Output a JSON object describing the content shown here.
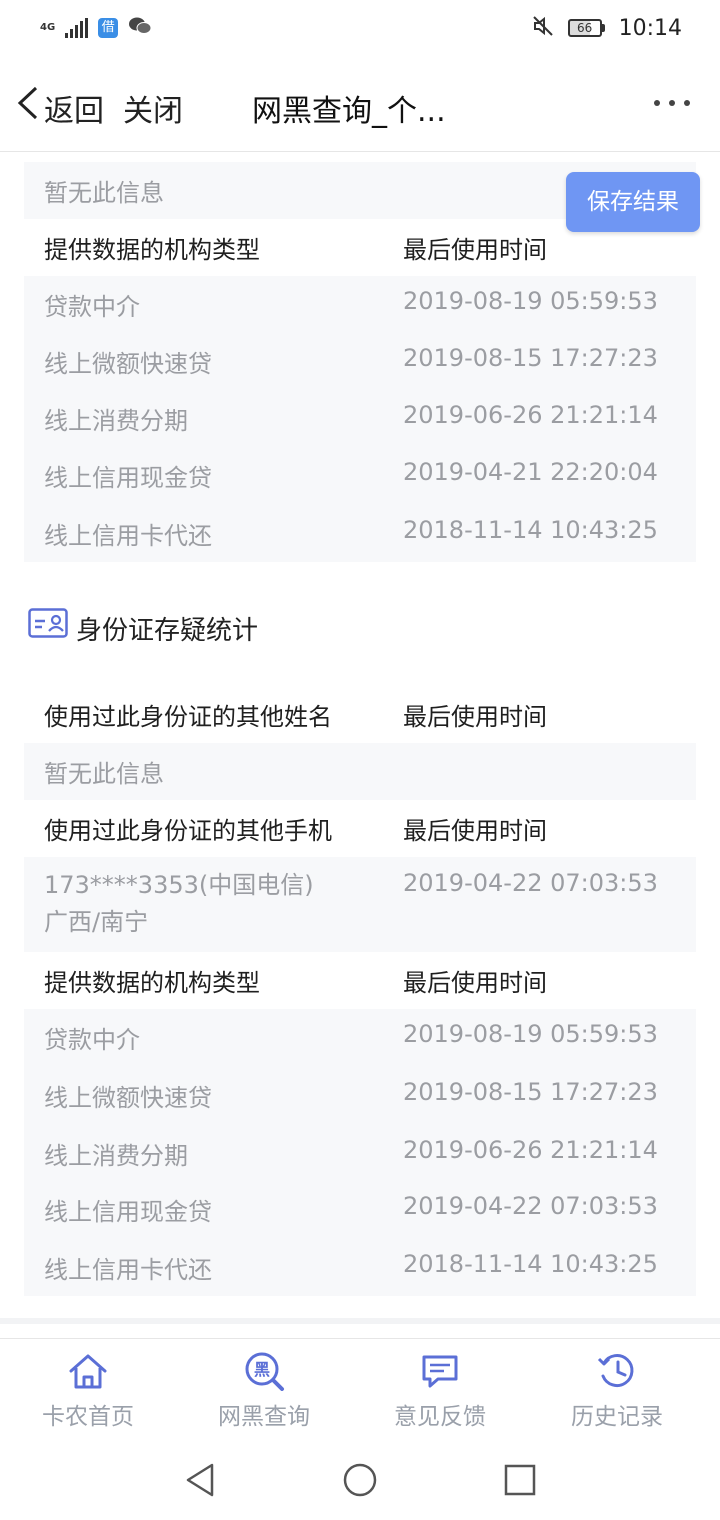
{
  "status_bar": {
    "network": "4G",
    "app_badge": "借",
    "battery": "66",
    "time": "10:14",
    "icons": [
      "signal-icon",
      "app-badge-icon",
      "wechat-icon",
      "mute-icon",
      "battery-icon"
    ]
  },
  "nav": {
    "back_label": "返回",
    "close_label": "关闭",
    "title": "网黑查询_个..."
  },
  "save_button": "保存结果",
  "section_a": {
    "no_info": "暂无此信息",
    "org_header": {
      "left": "提供数据的机构类型",
      "right": "最后使用时间"
    },
    "org_rows": [
      {
        "type": "贷款中介",
        "time": "2019-08-19 05:59:53"
      },
      {
        "type": "线上微额快速贷",
        "time": "2019-08-15 17:27:23"
      },
      {
        "type": "线上消费分期",
        "time": "2019-06-26 21:21:14"
      },
      {
        "type": "线上信用现金贷",
        "time": "2019-04-21 22:20:04"
      },
      {
        "type": "线上信用卡代还",
        "time": "2018-11-14 10:43:25"
      }
    ]
  },
  "section_b": {
    "title": "身份证存疑统计",
    "name_header": {
      "left": "使用过此身份证的其他姓名",
      "right": "最后使用时间"
    },
    "no_info": "暂无此信息",
    "phone_header": {
      "left": "使用过此身份证的其他手机",
      "right": "最后使用时间"
    },
    "phone_row": {
      "line1": "173****3353(中国电信)",
      "line2": "广西/南宁",
      "time": "2019-04-22 07:03:53"
    },
    "org_header": {
      "left": "提供数据的机构类型",
      "right": "最后使用时间"
    },
    "org_rows": [
      {
        "type": "贷款中介",
        "time": "2019-08-19 05:59:53"
      },
      {
        "type": "线上微额快速贷",
        "time": "2019-08-15 17:27:23"
      },
      {
        "type": "线上消费分期",
        "time": "2019-06-26 21:21:14"
      },
      {
        "type": "线上信用现金贷",
        "time": "2019-04-22 07:03:53"
      },
      {
        "type": "线上信用卡代还",
        "time": "2018-11-14 10:43:25"
      }
    ]
  },
  "tabs": [
    {
      "label": "卡农首页",
      "icon": "home-icon"
    },
    {
      "label": "网黑查询",
      "icon": "blacklist-search-icon",
      "glyph": "黑"
    },
    {
      "label": "意见反馈",
      "icon": "feedback-icon"
    },
    {
      "label": "历史记录",
      "icon": "history-icon"
    }
  ],
  "colors": {
    "accent": "#6f96f3",
    "icon_blue": "#5b6fd6",
    "muted_text": "#9b9da2",
    "tab_label": "#9aa0aa"
  }
}
